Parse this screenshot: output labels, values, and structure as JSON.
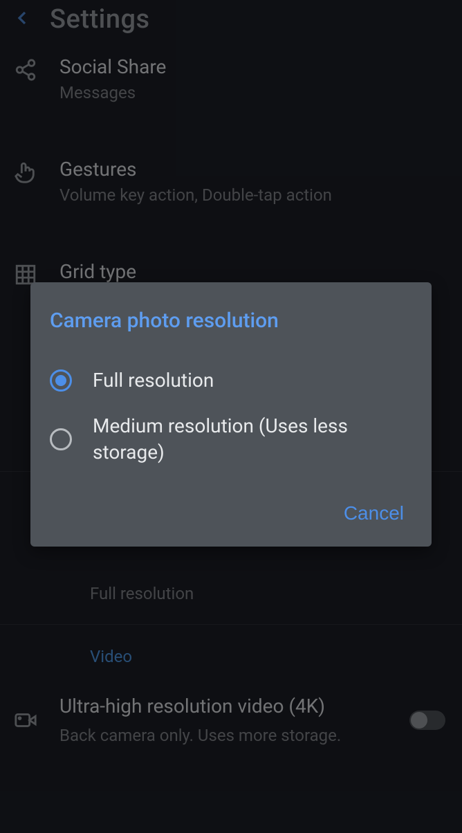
{
  "header": {
    "title": "Settings"
  },
  "items": {
    "social_share": {
      "title": "Social Share",
      "subtitle": "Messages"
    },
    "gestures": {
      "title": "Gestures",
      "subtitle": "Volume key action, Double-tap action"
    },
    "grid_type": {
      "title": "Grid type"
    },
    "camera_resolution_value": "Full resolution",
    "video_section": "Video",
    "uhd_video": {
      "title": "Ultra-high resolution video (4K)",
      "subtitle": "Back camera only. Uses more storage."
    }
  },
  "dialog": {
    "title": "Camera photo resolution",
    "options": {
      "full": "Full resolution",
      "medium": "Medium resolution (Uses less storage)"
    },
    "cancel": "Cancel"
  }
}
